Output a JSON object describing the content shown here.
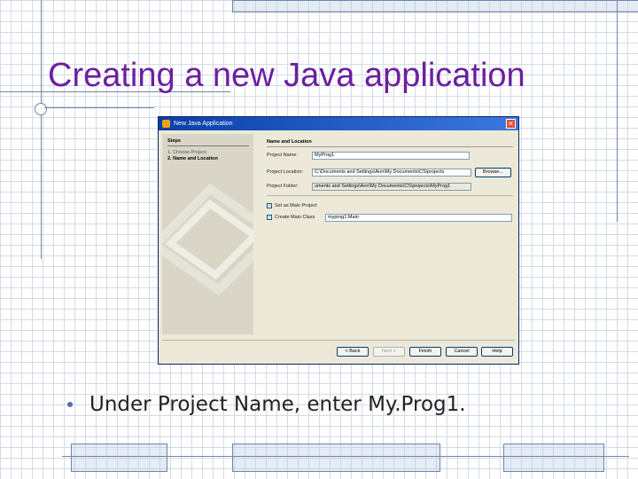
{
  "slide": {
    "title": "Creating a new Java application",
    "bullets": [
      "Under Project Name, enter My.Prog1."
    ]
  },
  "dialog": {
    "title": "New Java Application",
    "steps_header": "Steps",
    "steps": [
      "1.  Choose Project",
      "2.  Name and Location"
    ],
    "section_header": "Name and Location",
    "project_name_label": "Project Name:",
    "project_name_value": "MyProg1",
    "project_location_label": "Project Location:",
    "project_location_value": "C:\\Documents and Settings\\Ann\\My Documents\\CS\\projects",
    "browse_label": "Browse...",
    "project_folder_label": "Project Folder:",
    "project_folder_value": "uments and Settings\\Ann\\My Documents\\CS\\projects\\MyProg1",
    "set_main_label": "Set as Main Project",
    "create_main_label": "Create Main Class",
    "main_class_value": "myprog1.Main",
    "buttons": {
      "back": "< Back",
      "next": "Next >",
      "finish": "Finish",
      "cancel": "Cancel",
      "help": "Help"
    }
  },
  "colors": {
    "title": "#6c1fa0",
    "titlebar": "#0a3fa8",
    "frame": "#6f86a8"
  }
}
